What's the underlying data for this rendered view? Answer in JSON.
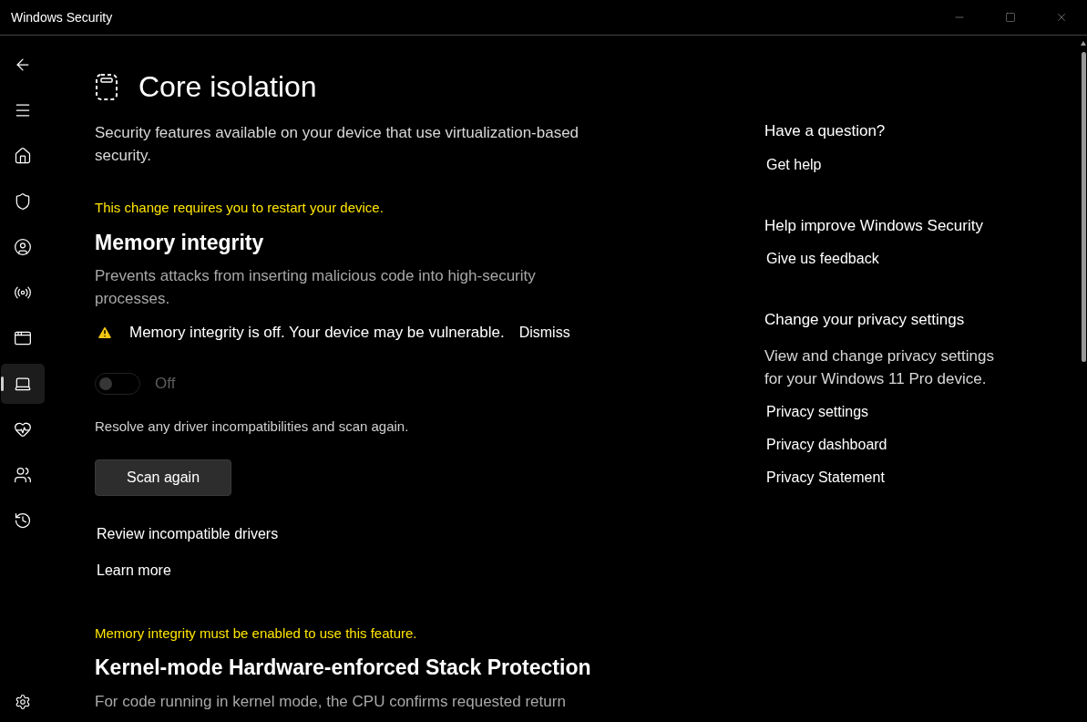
{
  "window": {
    "title": "Windows Security"
  },
  "sidebar": {
    "items": [
      {
        "selected": false
      },
      {
        "selected": false
      },
      {
        "selected": false
      },
      {
        "selected": false
      },
      {
        "selected": false
      },
      {
        "selected": false
      },
      {
        "selected": false
      },
      {
        "selected": true
      },
      {
        "selected": false
      },
      {
        "selected": false
      },
      {
        "selected": false
      }
    ]
  },
  "page": {
    "title": "Core isolation",
    "description": "Security features available on your device that use virtualization-based security."
  },
  "sections": [
    {
      "notice": "This change requires you to restart your device.",
      "heading": "Memory integrity",
      "description": "Prevents attacks from inserting malicious code into high-security processes.",
      "warning": {
        "text": "Memory integrity is off. Your device may be vulnerable.",
        "action": "Dismiss"
      },
      "toggle": {
        "on": false,
        "disabled": true,
        "label": "Off"
      },
      "hint": "Resolve any driver incompatibilities and scan again.",
      "button": "Scan again",
      "links": [
        "Review incompatible drivers",
        "Learn more"
      ]
    },
    {
      "notice": "Memory integrity must be enabled to use this feature.",
      "heading": "Kernel-mode Hardware-enforced Stack Protection",
      "description": "For code running in kernel mode, the CPU confirms requested return"
    }
  ],
  "aside": [
    {
      "heading": "Have a question?",
      "links": [
        "Get help"
      ]
    },
    {
      "heading": "Help improve Windows Security",
      "links": [
        "Give us feedback"
      ]
    },
    {
      "heading": "Change your privacy settings",
      "text": "View and change privacy settings for your Windows 11 Pro device.",
      "links": [
        "Privacy settings",
        "Privacy dashboard",
        "Privacy Statement"
      ]
    }
  ]
}
